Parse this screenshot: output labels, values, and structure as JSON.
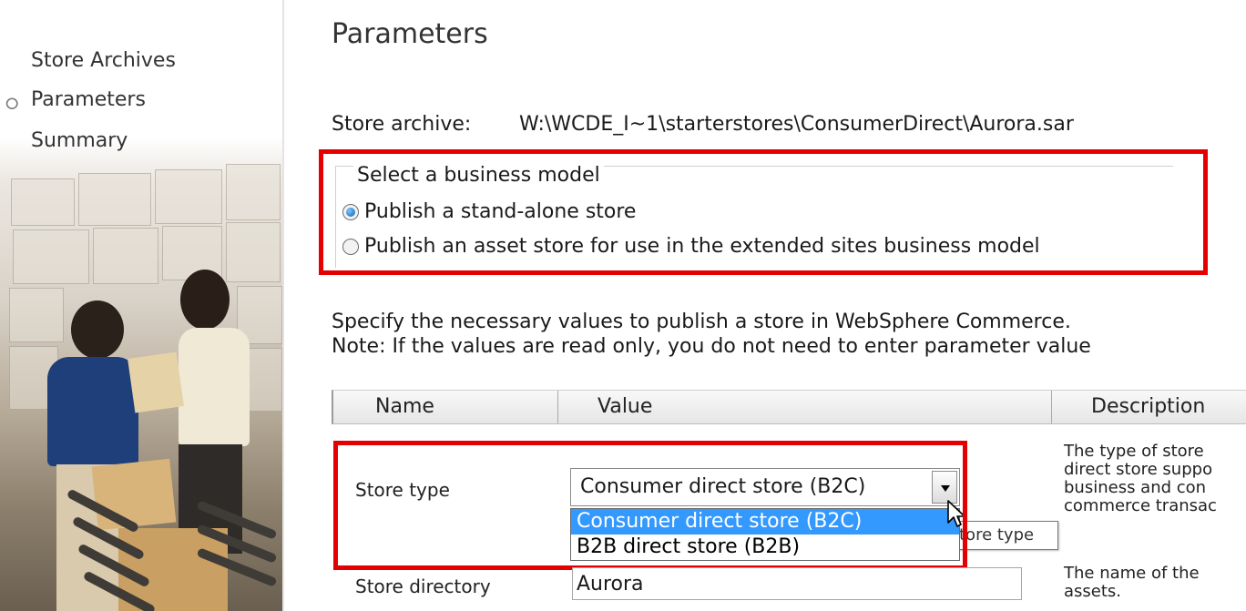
{
  "sidebar": {
    "items": [
      {
        "label": "Store Archives"
      },
      {
        "label": "Parameters"
      },
      {
        "label": "Summary"
      }
    ]
  },
  "main": {
    "title": "Parameters",
    "archive": {
      "label": "Store archive:",
      "path": "W:\\WCDE_I~1\\starterstores\\ConsumerDirect\\Aurora.sar"
    },
    "business_model": {
      "legend": "Select a business model",
      "options": [
        {
          "label": "Publish a stand-alone store",
          "checked": true
        },
        {
          "label": "Publish an asset store for use in the extended sites business model",
          "checked": false
        }
      ]
    },
    "instructions": [
      "Specify the necessary values to publish a store in WebSphere Commerce.",
      "Note: If the values are read only, you do not need to enter parameter value"
    ],
    "table": {
      "headers": {
        "name": "Name",
        "value": "Value",
        "description": "Description"
      },
      "rows": [
        {
          "name": "Store type",
          "value": "Consumer direct store (B2C)",
          "options": [
            "Consumer direct store (B2C)",
            "B2B direct store (B2B)"
          ],
          "tooltip": "tore type",
          "description": [
            "The type of store",
            "direct store suppo",
            "business and con",
            "commerce transac"
          ]
        },
        {
          "name": "Store directory",
          "value": "Aurora",
          "description": [
            "The name of the",
            "assets."
          ]
        }
      ]
    }
  },
  "colors": {
    "highlight": "#e40000",
    "selection": "#3399ff"
  },
  "icons": {
    "nav_current": "arrow-icon",
    "dropdown": "chevron-down-icon",
    "pointer": "mouse-cursor-icon"
  }
}
